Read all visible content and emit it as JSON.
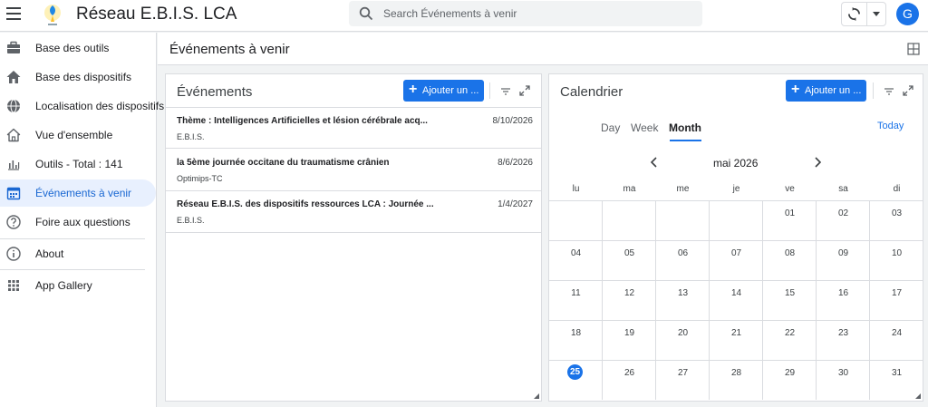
{
  "app": {
    "title": "Réseau E.B.I.S. LCA",
    "logo_text": "E.B.I.S."
  },
  "search": {
    "placeholder": "Search Événements à venir"
  },
  "user": {
    "avatar_letter": "G"
  },
  "colors": {
    "accent": "#1a73e8",
    "active_nav_bg": "#e8f0fe"
  },
  "sidebar": {
    "items": [
      {
        "label": "Base des outils",
        "icon": "toolbox-icon"
      },
      {
        "label": "Base des dispositifs",
        "icon": "home-icon"
      },
      {
        "label": "Localisation des dispositifs",
        "icon": "globe-icon"
      },
      {
        "label": "Vue d'ensemble",
        "icon": "home-outline-icon"
      },
      {
        "label": "Outils - Total : 141",
        "icon": "bar-chart-icon"
      },
      {
        "label": "Événements à venir",
        "icon": "calendar-icon",
        "active": true
      },
      {
        "label": "Foire aux questions",
        "icon": "help-icon"
      },
      {
        "label": "About",
        "icon": "info-icon"
      },
      {
        "label": "App Gallery",
        "icon": "apps-grid-icon"
      }
    ]
  },
  "main": {
    "title": "Événements à venir"
  },
  "events_panel": {
    "title": "Événements",
    "add_label": "Ajouter un ...",
    "events": [
      {
        "title": "Thème : Intelligences Artificielles et lésion cérébrale acq...",
        "date": "8/10/2026",
        "org": "E.B.I.S."
      },
      {
        "title": "la 5ème journée occitane du traumatisme crânien",
        "date": "8/6/2026",
        "org": "Optimips-TC"
      },
      {
        "title": "Réseau E.B.I.S. des dispositifs ressources LCA : Journée ...",
        "date": "1/4/2027",
        "org": "E.B.I.S."
      }
    ]
  },
  "calendar_panel": {
    "title": "Calendrier",
    "add_label": "Ajouter un ...",
    "views": [
      "Day",
      "Week",
      "Month"
    ],
    "active_view": "Month",
    "today_label": "Today",
    "month_label": "mai 2026",
    "weekdays": [
      "lu",
      "ma",
      "me",
      "je",
      "ve",
      "sa",
      "di"
    ],
    "weeks": [
      [
        "",
        "",
        "",
        "",
        "01",
        "02",
        "03"
      ],
      [
        "04",
        "05",
        "06",
        "07",
        "08",
        "09",
        "10"
      ],
      [
        "11",
        "12",
        "13",
        "14",
        "15",
        "16",
        "17"
      ],
      [
        "18",
        "19",
        "20",
        "21",
        "22",
        "23",
        "24"
      ],
      [
        "25",
        "26",
        "27",
        "28",
        "29",
        "30",
        "31"
      ]
    ],
    "today": "25"
  }
}
